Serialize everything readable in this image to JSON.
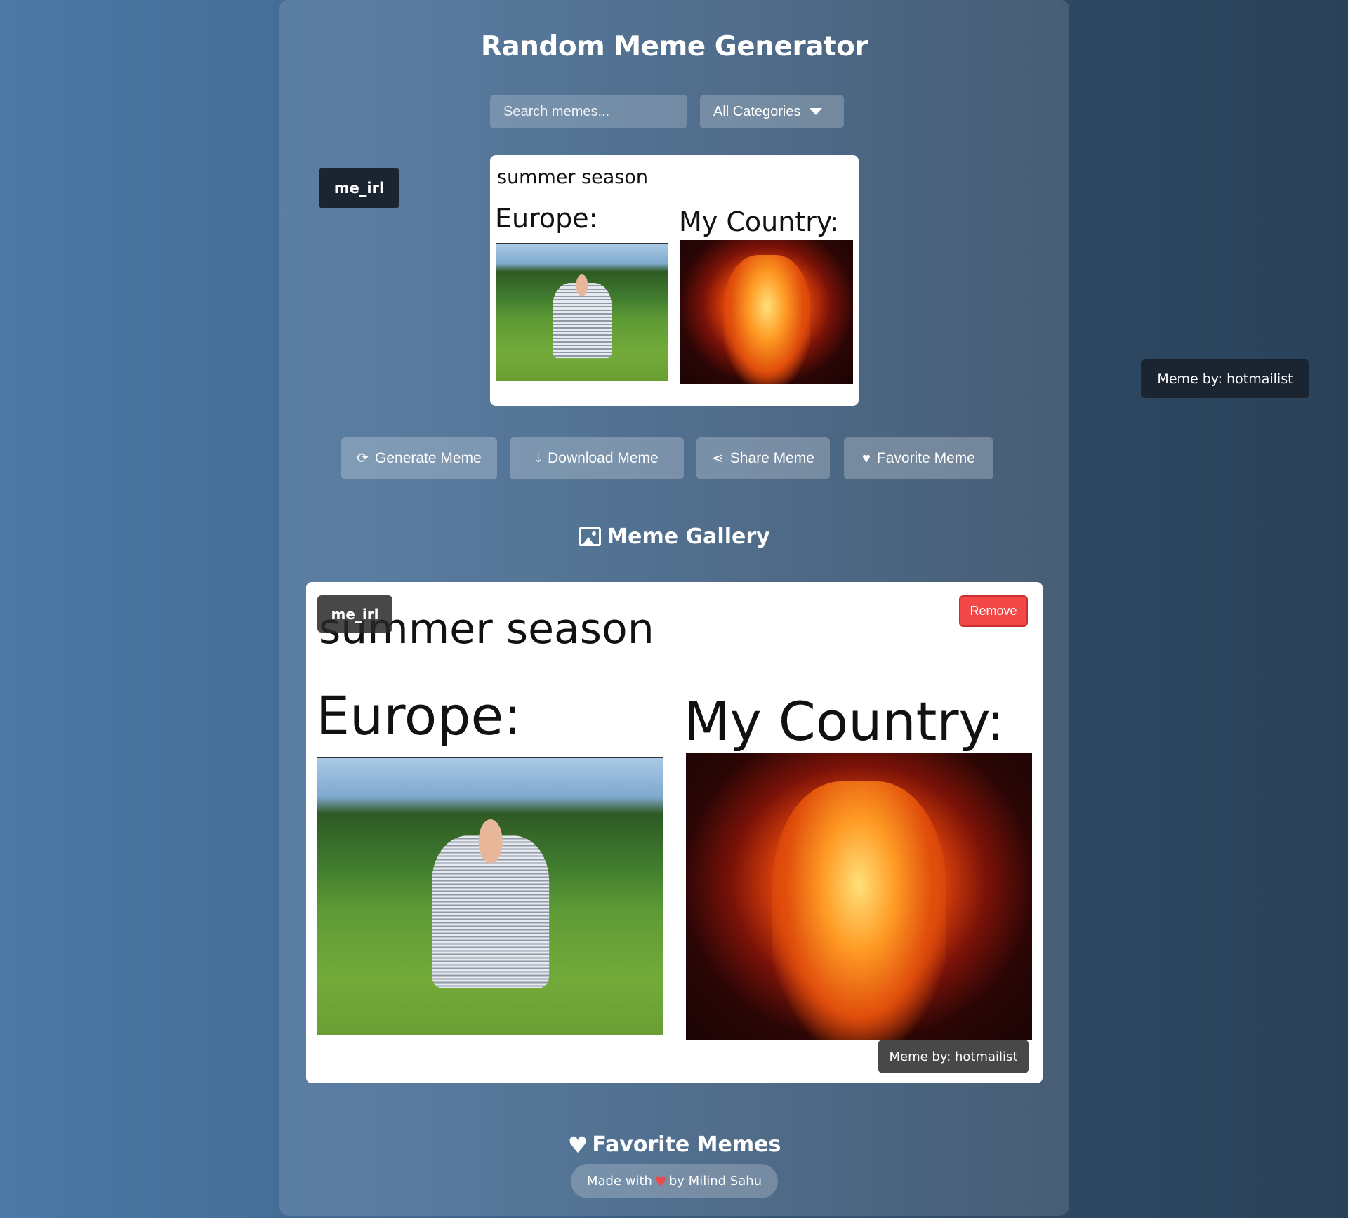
{
  "app": {
    "title": "Random Meme Generator"
  },
  "search": {
    "placeholder": "Search memes..."
  },
  "category": {
    "selected": "All Categories"
  },
  "current_meme": {
    "subreddit": "me_irl",
    "caption_top": "summer season",
    "label_left": "Europe:",
    "label_right": "My Country:",
    "author": "Meme by: hotmailist"
  },
  "actions": {
    "generate": "Generate Meme",
    "download": "Download Meme",
    "share": "Share Meme",
    "favorite": "Favorite Meme"
  },
  "gallery": {
    "title": "Meme Gallery",
    "items": [
      {
        "subreddit": "me_irl",
        "caption_top": "summer season",
        "label_left": "Europe:",
        "label_right": "My Country:",
        "author": "Meme by: hotmailist",
        "remove_label": "Remove"
      }
    ]
  },
  "favorites": {
    "title": "Favorite Memes"
  },
  "footer": {
    "prefix": "Made with",
    "suffix": "by Milind Sahu"
  },
  "icons": {
    "generate": "refresh-icon",
    "download": "download-icon",
    "share": "share-icon",
    "favorite": "heart-icon",
    "gallery": "image-icon"
  },
  "colors": {
    "tag_bg": "#1b2532",
    "remove_bg": "#f24848",
    "footer_heart": "#ef4b4b"
  }
}
